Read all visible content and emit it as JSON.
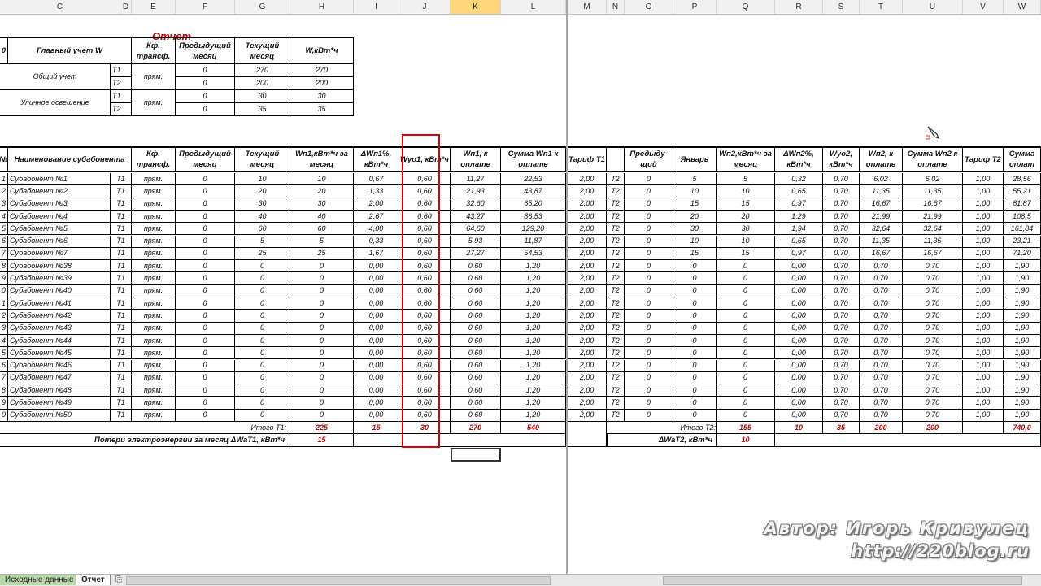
{
  "columns": [
    {
      "label": "C",
      "l": 0,
      "w": 148
    },
    {
      "label": "D",
      "l": 148,
      "w": 14
    },
    {
      "label": "E",
      "l": 162,
      "w": 54
    },
    {
      "label": "F",
      "l": 216,
      "w": 73
    },
    {
      "label": "G",
      "l": 289,
      "w": 68
    },
    {
      "label": "H",
      "l": 357,
      "w": 78
    },
    {
      "label": "I",
      "l": 435,
      "w": 56
    },
    {
      "label": "J",
      "l": 491,
      "w": 63
    },
    {
      "label": "K",
      "l": 554,
      "w": 62
    },
    {
      "label": "L",
      "l": 616,
      "w": 80
    },
    {
      "label": "M",
      "l": 698,
      "w": 48
    },
    {
      "label": "N",
      "l": 746,
      "w": 22
    },
    {
      "label": "O",
      "l": 768,
      "w": 60
    },
    {
      "label": "P",
      "l": 828,
      "w": 53
    },
    {
      "label": "Q",
      "l": 881,
      "w": 72
    },
    {
      "label": "R",
      "l": 953,
      "w": 59
    },
    {
      "label": "S",
      "l": 1012,
      "w": 45
    },
    {
      "label": "T",
      "l": 1057,
      "w": 53
    },
    {
      "label": "U",
      "l": 1110,
      "w": 74
    },
    {
      "label": "V",
      "l": 1184,
      "w": 50
    },
    {
      "label": "W",
      "l": 1234,
      "w": 46
    }
  ],
  "selected_column": "K",
  "report_title": "Отчет",
  "top_table": {
    "col0": "0",
    "headers": [
      "Главный учет W",
      "Кф. трансф.",
      "Предыдущий месяц",
      "Текущий месяц",
      "W,кВт*ч"
    ],
    "groups": [
      {
        "name": "Общий учет",
        "kf": "прям.",
        "rows": [
          {
            "t": "T1",
            "prev": "0",
            "cur": "270",
            "w": "270"
          },
          {
            "t": "T2",
            "prev": "0",
            "cur": "200",
            "w": "200"
          }
        ]
      },
      {
        "name": "Уличное освещение",
        "kf": "прям.",
        "rows": [
          {
            "t": "T1",
            "prev": "0",
            "cur": "30",
            "w": "30"
          },
          {
            "t": "T2",
            "prev": "0",
            "cur": "35",
            "w": "35"
          }
        ]
      }
    ]
  },
  "main_table": {
    "col0": "№",
    "left_headers": [
      "Наименование субабонента",
      "Кф. трансф.",
      "Предыдущий месяц",
      "Текущий месяц",
      "Wп1,кВт*ч за месяц",
      "ΔWп1%, кВт*ч",
      "Wуо1, кВт*ч",
      "Wп1, к оплате",
      "Сумма Wп1 к оплате",
      "Тариф T1"
    ],
    "right_headers": [
      "Предыду- щий",
      "Январь",
      "Wп2,кВт*ч за месяц",
      "ΔWп2%, кВт*ч",
      "Wуо2, кВт*ч",
      "Wп2, к оплате",
      "Сумма Wп2 к оплате",
      "Тариф T2",
      "Сумма оплат"
    ],
    "rows": [
      {
        "no": "1",
        "name": "Субабонент №1",
        "t1": "T1",
        "kf": "прям.",
        "prev": "0",
        "cur": "10",
        "wp1": "10",
        "dwp1": "0,67",
        "wuo1": "0,60",
        "pay1": "11,27",
        "sum1": "22,53",
        "tar1": "2,00",
        "t2": "T2",
        "prev2": "0",
        "jan": "5",
        "wp2": "5",
        "dwp2": "0,32",
        "wuo2": "0,70",
        "pay2": "6,02",
        "sum2": "6,02",
        "tar2": "1,00",
        "sumt": "28,56"
      },
      {
        "no": "2",
        "name": "Субабонент №2",
        "t1": "T1",
        "kf": "прям.",
        "prev": "0",
        "cur": "20",
        "wp1": "20",
        "dwp1": "1,33",
        "wuo1": "0,60",
        "pay1": "21,93",
        "sum1": "43,87",
        "tar1": "2,00",
        "t2": "T2",
        "prev2": "0",
        "jan": "10",
        "wp2": "10",
        "dwp2": "0,65",
        "wuo2": "0,70",
        "pay2": "11,35",
        "sum2": "11,35",
        "tar2": "1,00",
        "sumt": "55,21"
      },
      {
        "no": "3",
        "name": "Субабонент №3",
        "t1": "T1",
        "kf": "прям.",
        "prev": "0",
        "cur": "30",
        "wp1": "30",
        "dwp1": "2,00",
        "wuo1": "0,60",
        "pay1": "32,60",
        "sum1": "65,20",
        "tar1": "2,00",
        "t2": "T2",
        "prev2": "0",
        "jan": "15",
        "wp2": "15",
        "dwp2": "0,97",
        "wuo2": "0,70",
        "pay2": "16,67",
        "sum2": "16,67",
        "tar2": "1,00",
        "sumt": "81,87"
      },
      {
        "no": "4",
        "name": "Субабонент №4",
        "t1": "T1",
        "kf": "прям.",
        "prev": "0",
        "cur": "40",
        "wp1": "40",
        "dwp1": "2,67",
        "wuo1": "0,60",
        "pay1": "43,27",
        "sum1": "86,53",
        "tar1": "2,00",
        "t2": "T2",
        "prev2": "0",
        "jan": "20",
        "wp2": "20",
        "dwp2": "1,29",
        "wuo2": "0,70",
        "pay2": "21,99",
        "sum2": "21,99",
        "tar2": "1,00",
        "sumt": "108,5"
      },
      {
        "no": "5",
        "name": "Субабонент №5",
        "t1": "T1",
        "kf": "прям.",
        "prev": "0",
        "cur": "60",
        "wp1": "60",
        "dwp1": "4,00",
        "wuo1": "0,60",
        "pay1": "64,60",
        "sum1": "129,20",
        "tar1": "2,00",
        "t2": "T2",
        "prev2": "0",
        "jan": "30",
        "wp2": "30",
        "dwp2": "1,94",
        "wuo2": "0,70",
        "pay2": "32,64",
        "sum2": "32,64",
        "tar2": "1,00",
        "sumt": "161,84"
      },
      {
        "no": "6",
        "name": "Субабонент №6",
        "t1": "T1",
        "kf": "прям.",
        "prev": "0",
        "cur": "5",
        "wp1": "5",
        "dwp1": "0,33",
        "wuo1": "0,60",
        "pay1": "5,93",
        "sum1": "11,87",
        "tar1": "2,00",
        "t2": "T2",
        "prev2": "0",
        "jan": "10",
        "wp2": "10",
        "dwp2": "0,65",
        "wuo2": "0,70",
        "pay2": "11,35",
        "sum2": "11,35",
        "tar2": "1,00",
        "sumt": "23,21"
      },
      {
        "no": "7",
        "name": "Субабонент №7",
        "t1": "T1",
        "kf": "прям.",
        "prev": "0",
        "cur": "25",
        "wp1": "25",
        "dwp1": "1,67",
        "wuo1": "0,60",
        "pay1": "27,27",
        "sum1": "54,53",
        "tar1": "2,00",
        "t2": "T2",
        "prev2": "0",
        "jan": "15",
        "wp2": "15",
        "dwp2": "0,97",
        "wuo2": "0,70",
        "pay2": "16,67",
        "sum2": "16,67",
        "tar2": "1,00",
        "sumt": "71,20"
      },
      {
        "no": "8",
        "name": "Субабонент №38",
        "t1": "T1",
        "kf": "прям.",
        "prev": "0",
        "cur": "0",
        "wp1": "0",
        "dwp1": "0,00",
        "wuo1": "0,60",
        "pay1": "0,60",
        "sum1": "1,20",
        "tar1": "2,00",
        "t2": "T2",
        "prev2": "0",
        "jan": "0",
        "wp2": "0",
        "dwp2": "0,00",
        "wuo2": "0,70",
        "pay2": "0,70",
        "sum2": "0,70",
        "tar2": "1,00",
        "sumt": "1,90"
      },
      {
        "no": "9",
        "name": "Субабонент №39",
        "t1": "T1",
        "kf": "прям.",
        "prev": "0",
        "cur": "0",
        "wp1": "0",
        "dwp1": "0,00",
        "wuo1": "0,60",
        "pay1": "0,60",
        "sum1": "1,20",
        "tar1": "2,00",
        "t2": "T2",
        "prev2": "0",
        "jan": "0",
        "wp2": "0",
        "dwp2": "0,00",
        "wuo2": "0,70",
        "pay2": "0,70",
        "sum2": "0,70",
        "tar2": "1,00",
        "sumt": "1,90"
      },
      {
        "no": "0",
        "name": "Субабонент №40",
        "t1": "T1",
        "kf": "прям.",
        "prev": "0",
        "cur": "0",
        "wp1": "0",
        "dwp1": "0,00",
        "wuo1": "0,60",
        "pay1": "0,60",
        "sum1": "1,20",
        "tar1": "2,00",
        "t2": "T2",
        "prev2": "0",
        "jan": "0",
        "wp2": "0",
        "dwp2": "0,00",
        "wuo2": "0,70",
        "pay2": "0,70",
        "sum2": "0,70",
        "tar2": "1,00",
        "sumt": "1,90"
      },
      {
        "no": "1",
        "name": "Субабонент №41",
        "t1": "T1",
        "kf": "прям.",
        "prev": "0",
        "cur": "0",
        "wp1": "0",
        "dwp1": "0,00",
        "wuo1": "0,60",
        "pay1": "0,60",
        "sum1": "1,20",
        "tar1": "2,00",
        "t2": "T2",
        "prev2": "0",
        "jan": "0",
        "wp2": "0",
        "dwp2": "0,00",
        "wuo2": "0,70",
        "pay2": "0,70",
        "sum2": "0,70",
        "tar2": "1,00",
        "sumt": "1,90"
      },
      {
        "no": "2",
        "name": "Субабонент №42",
        "t1": "T1",
        "kf": "прям.",
        "prev": "0",
        "cur": "0",
        "wp1": "0",
        "dwp1": "0,00",
        "wuo1": "0,60",
        "pay1": "0,60",
        "sum1": "1,20",
        "tar1": "2,00",
        "t2": "T2",
        "prev2": "0",
        "jan": "0",
        "wp2": "0",
        "dwp2": "0,00",
        "wuo2": "0,70",
        "pay2": "0,70",
        "sum2": "0,70",
        "tar2": "1,00",
        "sumt": "1,90"
      },
      {
        "no": "3",
        "name": "Субабонент №43",
        "t1": "T1",
        "kf": "прям.",
        "prev": "0",
        "cur": "0",
        "wp1": "0",
        "dwp1": "0,00",
        "wuo1": "0,60",
        "pay1": "0,60",
        "sum1": "1,20",
        "tar1": "2,00",
        "t2": "T2",
        "prev2": "0",
        "jan": "0",
        "wp2": "0",
        "dwp2": "0,00",
        "wuo2": "0,70",
        "pay2": "0,70",
        "sum2": "0,70",
        "tar2": "1,00",
        "sumt": "1,90"
      },
      {
        "no": "4",
        "name": "Субабонент №44",
        "t1": "T1",
        "kf": "прям.",
        "prev": "0",
        "cur": "0",
        "wp1": "0",
        "dwp1": "0,00",
        "wuo1": "0,60",
        "pay1": "0,60",
        "sum1": "1,20",
        "tar1": "2,00",
        "t2": "T2",
        "prev2": "0",
        "jan": "0",
        "wp2": "0",
        "dwp2": "0,00",
        "wuo2": "0,70",
        "pay2": "0,70",
        "sum2": "0,70",
        "tar2": "1,00",
        "sumt": "1,90"
      },
      {
        "no": "5",
        "name": "Субабонент №45",
        "t1": "T1",
        "kf": "прям.",
        "prev": "0",
        "cur": "0",
        "wp1": "0",
        "dwp1": "0,00",
        "wuo1": "0,60",
        "pay1": "0,60",
        "sum1": "1,20",
        "tar1": "2,00",
        "t2": "T2",
        "prev2": "0",
        "jan": "0",
        "wp2": "0",
        "dwp2": "0,00",
        "wuo2": "0,70",
        "pay2": "0,70",
        "sum2": "0,70",
        "tar2": "1,00",
        "sumt": "1,90"
      },
      {
        "no": "6",
        "name": "Субабонент №46",
        "t1": "T1",
        "kf": "прям.",
        "prev": "0",
        "cur": "0",
        "wp1": "0",
        "dwp1": "0,00",
        "wuo1": "0,60",
        "pay1": "0,60",
        "sum1": "1,20",
        "tar1": "2,00",
        "t2": "T2",
        "prev2": "0",
        "jan": "0",
        "wp2": "0",
        "dwp2": "0,00",
        "wuo2": "0,70",
        "pay2": "0,70",
        "sum2": "0,70",
        "tar2": "1,00",
        "sumt": "1,90"
      },
      {
        "no": "7",
        "name": "Субабонент №47",
        "t1": "T1",
        "kf": "прям.",
        "prev": "0",
        "cur": "0",
        "wp1": "0",
        "dwp1": "0,00",
        "wuo1": "0,60",
        "pay1": "0,60",
        "sum1": "1,20",
        "tar1": "2,00",
        "t2": "T2",
        "prev2": "0",
        "jan": "0",
        "wp2": "0",
        "dwp2": "0,00",
        "wuo2": "0,70",
        "pay2": "0,70",
        "sum2": "0,70",
        "tar2": "1,00",
        "sumt": "1,90"
      },
      {
        "no": "8",
        "name": "Субабонент №48",
        "t1": "T1",
        "kf": "прям.",
        "prev": "0",
        "cur": "0",
        "wp1": "0",
        "dwp1": "0,00",
        "wuo1": "0,60",
        "pay1": "0,60",
        "sum1": "1,20",
        "tar1": "2,00",
        "t2": "T2",
        "prev2": "0",
        "jan": "0",
        "wp2": "0",
        "dwp2": "0,00",
        "wuo2": "0,70",
        "pay2": "0,70",
        "sum2": "0,70",
        "tar2": "1,00",
        "sumt": "1,90"
      },
      {
        "no": "9",
        "name": "Субабонент №49",
        "t1": "T1",
        "kf": "прям.",
        "prev": "0",
        "cur": "0",
        "wp1": "0",
        "dwp1": "0,00",
        "wuo1": "0,60",
        "pay1": "0,60",
        "sum1": "1,20",
        "tar1": "2,00",
        "t2": "T2",
        "prev2": "0",
        "jan": "0",
        "wp2": "0",
        "dwp2": "0,00",
        "wuo2": "0,70",
        "pay2": "0,70",
        "sum2": "0,70",
        "tar2": "1,00",
        "sumt": "1,90"
      },
      {
        "no": "0",
        "name": "Субабонент №50",
        "t1": "T1",
        "kf": "прям.",
        "prev": "0",
        "cur": "0",
        "wp1": "0",
        "dwp1": "0,00",
        "wuo1": "0,60",
        "pay1": "0,60",
        "sum1": "1,20",
        "tar1": "2,00",
        "t2": "T2",
        "prev2": "0",
        "jan": "0",
        "wp2": "0",
        "dwp2": "0,00",
        "wuo2": "0,70",
        "pay2": "0,70",
        "sum2": "0,70",
        "tar2": "1,00",
        "sumt": "1,90"
      }
    ],
    "totals_t1": {
      "label": "Итого T1:",
      "wp1": "225",
      "dwp1": "15",
      "wuo1": "30",
      "pay1": "270",
      "sum1": "540"
    },
    "totals_t2": {
      "label": "Итого T2:",
      "wp2": "155",
      "dwp2": "10",
      "wuo2": "35",
      "pay2": "200",
      "sum2": "200",
      "sumt": "740,0"
    },
    "loss_t1": {
      "label": "Потери электроэнергии за месяц ΔWaT1, кВт*ч",
      "value": "15"
    },
    "loss_t2": {
      "label": "ΔWaT2, кВт*ч",
      "value": "10"
    }
  },
  "sheet_tabs": [
    {
      "label": "Исходные данные",
      "active": false
    },
    {
      "label": "Отчет",
      "active": true
    }
  ],
  "watermark": {
    "line1": "Автор: Игорь Кривулец",
    "line2": "http://220blog.ru"
  },
  "colors": {
    "accent_red": "#c00000",
    "selection_red": "#dd0000",
    "header_selected": "#ffd77a"
  }
}
